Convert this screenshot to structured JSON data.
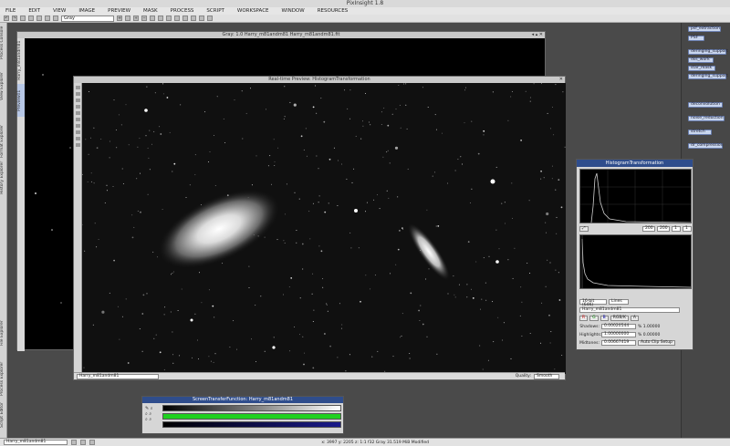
{
  "app": {
    "title": "PixInsight 1.8"
  },
  "menu": [
    "FILE",
    "EDIT",
    "VIEW",
    "IMAGE",
    "PREVIEW",
    "MASK",
    "PROCESS",
    "SCRIPT",
    "WORKSPACE",
    "WINDOW",
    "RESOURCES"
  ],
  "toolbar": {
    "colorspace_select": "Gray"
  },
  "left_tabs": [
    "Process Console",
    "View Explorer",
    "Format Explorer",
    "History Explorer",
    "Process Explorer",
    "File Explorer",
    "Image Explorer",
    "Script Editor",
    "Object Explorer"
  ],
  "right_icons": [
    "psf_extraction",
    "PSF",
    "deringing_support",
    "dss_work",
    "star_mask",
    "deringing_support",
    "deconvolution",
    "noise_reduction",
    "stretch",
    "dr_compression"
  ],
  "main_window": {
    "title": "Gray: 1.0 Harry_m81andm81  Harry_m81andm81.fit",
    "side_tabs": [
      "Harry_m81andm81",
      "Preview01"
    ]
  },
  "preview_window": {
    "title": "Real-time Preview: HistogramTransformation",
    "view_select": "Harry_m81andm81",
    "quality_label": "Quality:",
    "quality_value": "Smooth"
  },
  "histogram_transformation": {
    "title": "HistogramTransformation",
    "zoom_h": "200",
    "zoom_v": "200",
    "spin_a": "1",
    "spin_b": "1",
    "bits_select": "16-bit (64K)",
    "graph_select": "Lines",
    "target_view": "Harry_m81andm81",
    "channels": [
      "R",
      "G",
      "B",
      "K",
      "A"
    ],
    "combo_rgb": "RGB/K",
    "shadows_label": "Shadows:",
    "shadows_value": "0.00020544",
    "shadows_pct": "% 1.00000",
    "highlights_label": "Highlights:",
    "highlights_value": "1.00000000",
    "highlights_pct": "% 0.00000",
    "midtones_label": "Midtones:",
    "midtones_value": "0.00667419",
    "autoclip_label": "Auto Clip Setup"
  },
  "screen_transfer": {
    "title": "ScreenTransferFunction: Harry_m81andm81",
    "colors": {
      "r": "#000000",
      "g": "#1fd11f",
      "b": "#1a1a8a"
    }
  },
  "status": {
    "view_select": "Harry_m81andm81",
    "coords": "x: 3997  y: 2205  z: 1:1  f32  Gray  31.519 MiB  Modified"
  }
}
